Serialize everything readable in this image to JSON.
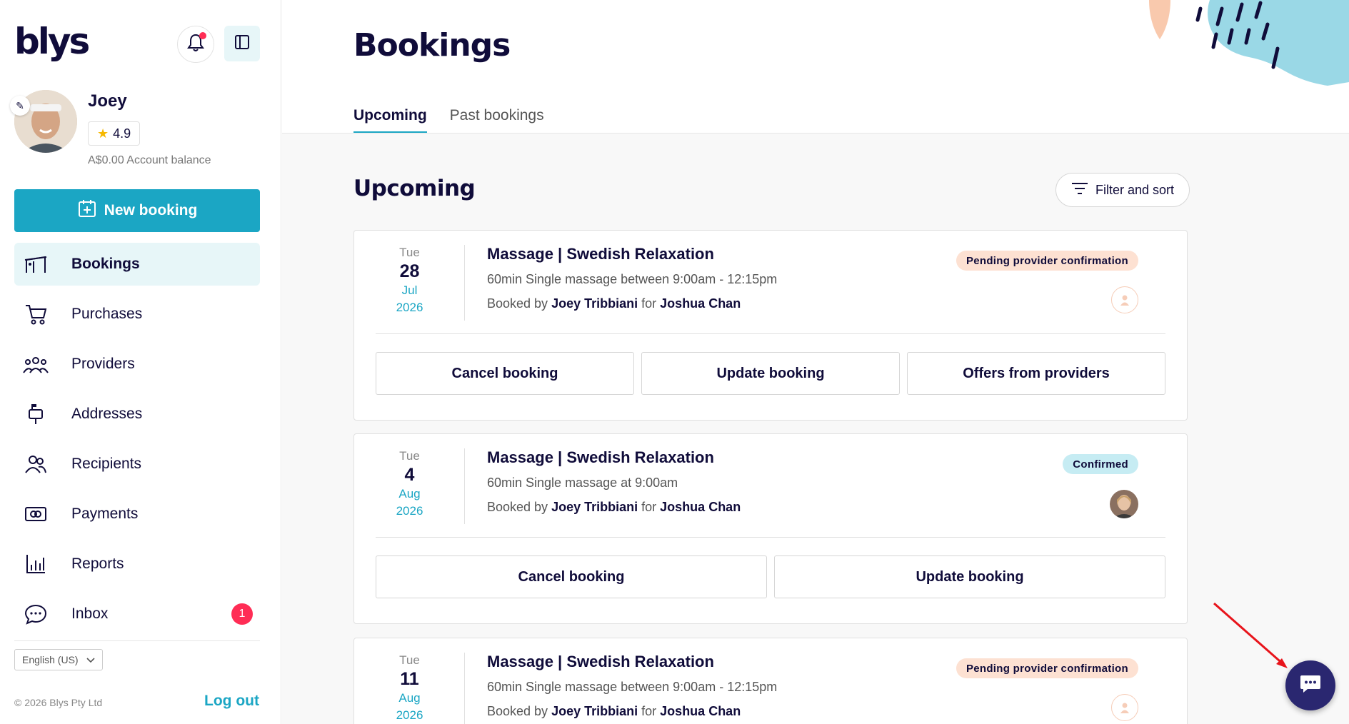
{
  "app": {
    "logo": "blys"
  },
  "user": {
    "name": "Joey",
    "rating": "4.9",
    "balance": "A$0.00 Account balance"
  },
  "sidebar": {
    "new_booking_label": "New booking",
    "items": [
      {
        "label": "Bookings",
        "icon": "bookings-icon"
      },
      {
        "label": "Purchases",
        "icon": "cart-icon"
      },
      {
        "label": "Providers",
        "icon": "providers-icon"
      },
      {
        "label": "Addresses",
        "icon": "address-icon"
      },
      {
        "label": "Recipients",
        "icon": "recipients-icon"
      },
      {
        "label": "Payments",
        "icon": "payments-icon"
      },
      {
        "label": "Reports",
        "icon": "reports-icon"
      },
      {
        "label": "Inbox",
        "icon": "chat-icon",
        "badge": "1"
      }
    ],
    "language": "English (US)",
    "copyright": "© 2026 Blys Pty Ltd",
    "logout_label": "Log out"
  },
  "main": {
    "title": "Bookings",
    "tabs": [
      {
        "label": "Upcoming",
        "active": true
      },
      {
        "label": "Past bookings",
        "active": false
      }
    ],
    "section_title": "Upcoming",
    "filter_label": "Filter and sort",
    "bookings": [
      {
        "dow": "Tue",
        "day": "28",
        "month": "Jul",
        "year": "2026",
        "title": "Massage | Swedish Relaxation",
        "detail": "60min Single massage between 9:00am - 12:15pm",
        "booked_by_prefix": "Booked by",
        "booked_by": "Joey Tribbiani",
        "for_word": "for",
        "recipient": "Joshua Chan",
        "status": "Pending provider confirmation",
        "actions": [
          "Cancel booking",
          "Update booking",
          "Offers from providers"
        ]
      },
      {
        "dow": "Tue",
        "day": "4",
        "month": "Aug",
        "year": "2026",
        "title": "Massage | Swedish Relaxation",
        "detail": "60min Single massage at 9:00am",
        "booked_by_prefix": "Booked by",
        "booked_by": "Joey Tribbiani",
        "for_word": "for",
        "recipient": "Joshua Chan",
        "status": "Confirmed",
        "actions": [
          "Cancel booking",
          "Update booking"
        ]
      },
      {
        "dow": "Tue",
        "day": "11",
        "month": "Aug",
        "year": "2026",
        "title": "Massage | Swedish Relaxation",
        "detail": "60min Single massage between 9:00am - 12:15pm",
        "booked_by_prefix": "Booked by",
        "booked_by": "Joey Tribbiani",
        "for_word": "for",
        "recipient": "Joshua Chan",
        "status": "Pending provider confirmation"
      }
    ]
  },
  "colors": {
    "accent": "#1ba6c4",
    "navy": "#100c3a",
    "pending_bg": "#fde1d2",
    "confirmed_bg": "#c6ecf3",
    "badge": "#ff2d55"
  }
}
